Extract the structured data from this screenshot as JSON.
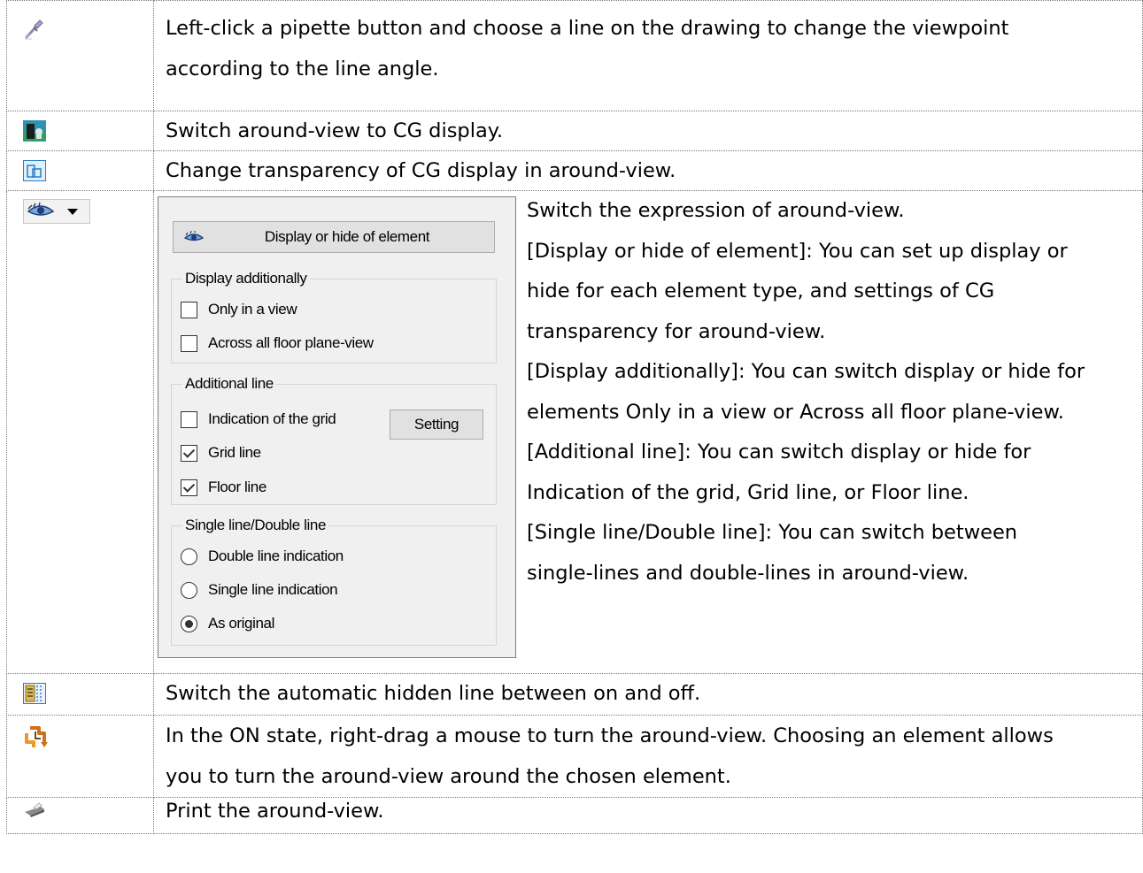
{
  "rows": [
    {
      "icon": "eyedropper-icon",
      "lines": [
        "Left-click a pipette button and choose a line on the drawing to change the viewpoint",
        "according to the line angle."
      ]
    },
    {
      "icon": "cg-display-icon",
      "lines": [
        "Switch around-view to CG display."
      ]
    },
    {
      "icon": "transparency-icon",
      "lines": [
        "Change transparency of CG display in around-view."
      ]
    },
    {
      "icon": "eye-dropdown-icon",
      "lines": [
        "Switch the expression of around-view.",
        "[Display or hide of element]: You can set up display or",
        "hide for each element type, and settings of CG",
        "transparency for around-view.",
        "[Display additionally]: You can switch display or hide for",
        "elements Only in a view or Across all floor plane-view.",
        "[Additional line]: You can switch display or hide for",
        "Indication of the grid, Grid line, or Floor line.",
        "[Single line/Double line]: You can switch between",
        "single-lines and double-lines in around-view."
      ]
    },
    {
      "icon": "hidden-line-icon",
      "lines": [
        "Switch the automatic hidden line between on and off."
      ]
    },
    {
      "icon": "rotate-view-icon",
      "lines": [
        "In the ON state, right-drag a mouse to turn the around-view. Choosing an element allows",
        "you to turn the around-view around the chosen element."
      ]
    },
    {
      "icon": "print-icon",
      "lines": [
        "Print the around-view."
      ]
    }
  ],
  "panel": {
    "main_button": "Display or hide of element",
    "display_additionally": {
      "title": "Display additionally",
      "options": [
        {
          "label": "Only in a view",
          "checked": false
        },
        {
          "label": "Across all floor plane-view",
          "checked": false
        }
      ]
    },
    "additional_line": {
      "title": "Additional line",
      "options": [
        {
          "label": "Indication of the grid",
          "checked": false
        },
        {
          "label": "Grid line",
          "checked": true
        },
        {
          "label": "Floor line",
          "checked": true
        }
      ],
      "setting_button": "Setting"
    },
    "single_double": {
      "title": "Single line/Double line",
      "options": [
        {
          "label": "Double line indication",
          "selected": false
        },
        {
          "label": "Single line indication",
          "selected": false
        },
        {
          "label": "As original",
          "selected": true
        }
      ]
    }
  }
}
